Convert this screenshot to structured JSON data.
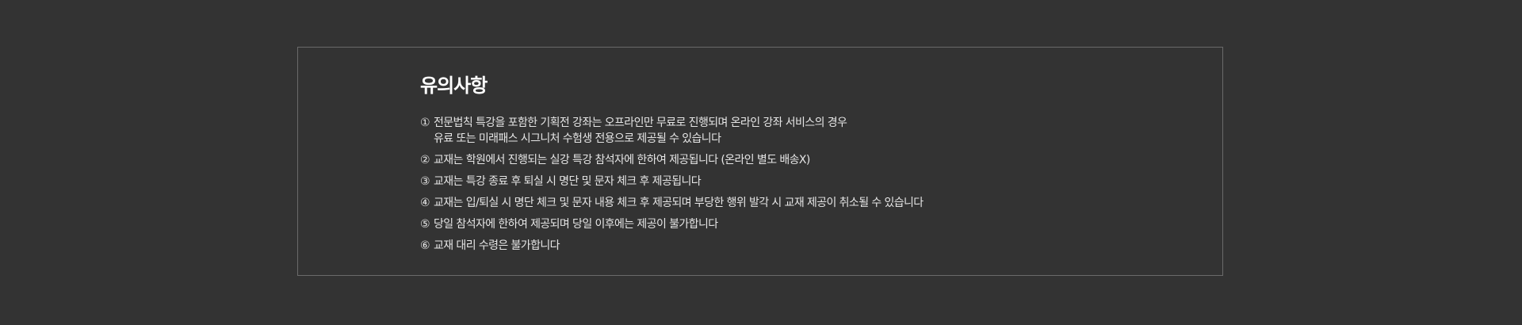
{
  "notice": {
    "title": "유의사항",
    "items": [
      {
        "num": "①",
        "lines": [
          "전문법칙 특강을 포함한 기획전 강좌는 오프라인만 무료로 진행되며 온라인 강좌 서비스의 경우",
          "유료 또는 미래패스 시그니처 수험생 전용으로 제공될 수 있습니다"
        ]
      },
      {
        "num": "②",
        "lines": [
          "교재는 학원에서 진행되는 실강 특강 참석자에 한하여 제공됩니다 (온라인 별도 배송X)"
        ]
      },
      {
        "num": "③",
        "lines": [
          "교재는 특강 종료 후 퇴실 시 명단 및 문자 체크 후 제공됩니다"
        ]
      },
      {
        "num": "④",
        "lines": [
          "교재는 입/퇴실 시 명단 체크 및 문자 내용 체크 후 제공되며 부당한 행위 발각 시 교재 제공이 취소될 수 있습니다"
        ]
      },
      {
        "num": "⑤",
        "lines": [
          "당일 참석자에 한하여 제공되며 당일 이후에는 제공이 불가합니다"
        ]
      },
      {
        "num": "⑥",
        "lines": [
          "교재 대리 수령은 불가합니다"
        ]
      }
    ]
  }
}
